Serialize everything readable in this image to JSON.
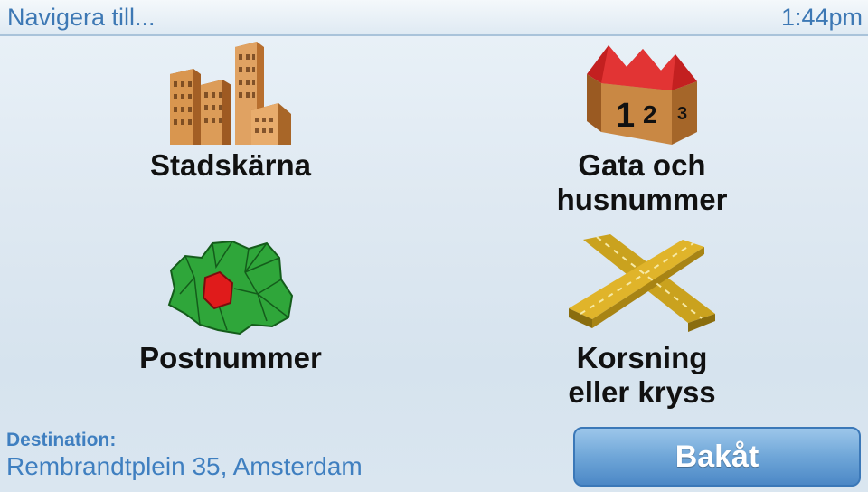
{
  "header": {
    "title": "Navigera till...",
    "time": "1:44pm"
  },
  "menu": {
    "city_center": {
      "label": "Stadskärna",
      "icon": "city-buildings-icon"
    },
    "street": {
      "label": "Gata och\nhusnummer",
      "icon": "house-numbers-icon",
      "numbers": [
        "1",
        "2",
        "3"
      ]
    },
    "postcode": {
      "label": "Postnummer",
      "icon": "postcode-map-icon"
    },
    "crossing": {
      "label": "Korsning\neller kryss",
      "icon": "crossroads-icon"
    }
  },
  "destination": {
    "label": "Destination:",
    "value": "Rembrandtplein 35, Amsterdam"
  },
  "back_button": {
    "label": "Bakåt"
  },
  "colors": {
    "accent": "#3d78b4",
    "button": "#6fa6d8",
    "map_green": "#2fa63a",
    "map_red": "#e01b1b"
  }
}
